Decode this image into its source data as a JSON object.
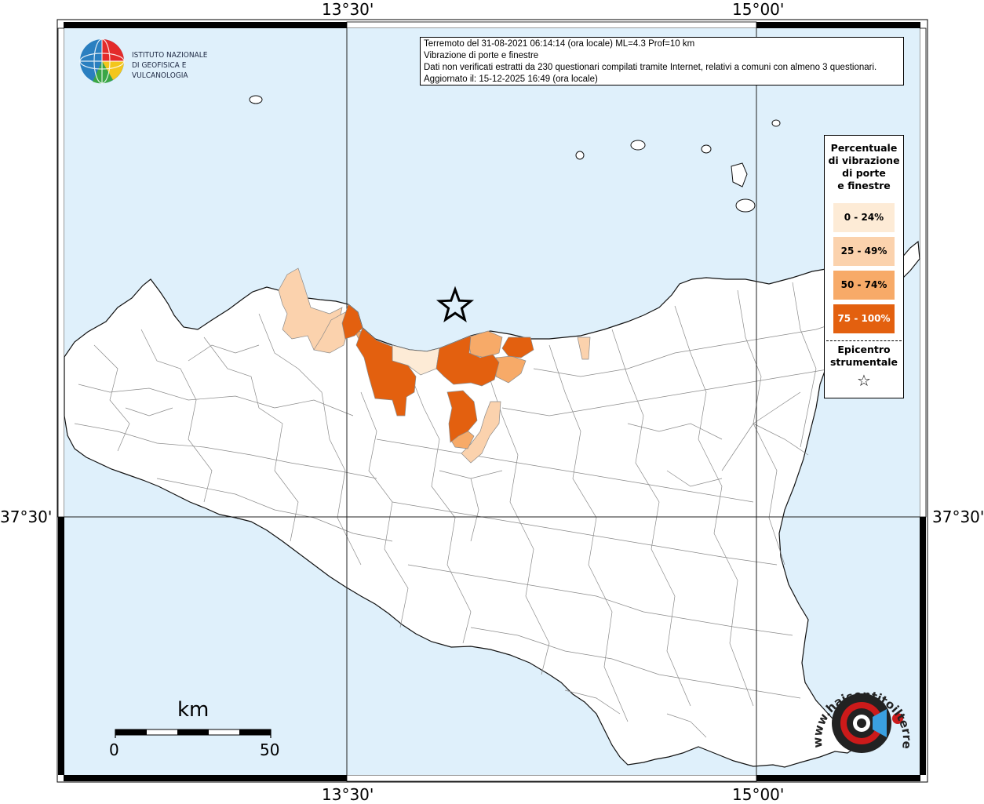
{
  "map": {
    "water_color": "#dff0fb",
    "land_color": "#ffffff",
    "border_color": "#8a8a8a",
    "coastline_color": "#111111",
    "graticule_color": "#222222"
  },
  "coords": {
    "top_left": "13°30'",
    "top_right": "15°00'",
    "bottom_left": "13°30'",
    "bottom_right": "15°00'",
    "left_lat": "37°30'",
    "right_lat": "37°30'"
  },
  "info": {
    "line1": "Terremoto del 31-08-2021 06:14:14 (ora locale) ML=4.3 Prof=10 km",
    "line2": "Vibrazione di porte e finestre",
    "line3": "Dati non verificati estratti da 230 questionari compilati tramite Internet, relativi a comuni con almeno 3 questionari.",
    "line4": "Aggiornato il: 15-12-2025 16:49 (ora locale)"
  },
  "legend": {
    "title": "Percentuale\ndi vibrazione\ndi porte\ne finestre",
    "classes": [
      {
        "label": "0 - 24%",
        "color": "#fdebd6",
        "text_color": "#000000"
      },
      {
        "label": "25 - 49%",
        "color": "#fbd2ad",
        "text_color": "#000000"
      },
      {
        "label": "50 - 74%",
        "color": "#f7aa68",
        "text_color": "#000000"
      },
      {
        "label": "75 - 100%",
        "color": "#e3600f",
        "text_color": "#ffffff"
      }
    ],
    "epicenter_title": "Epicentro\nstrumentale",
    "epicenter_symbol": "☆"
  },
  "logo": {
    "text": "ISTITUTO NAZIONALE\nDI GEOFISICA E VULCANOLOGIA",
    "icon": "ingv-globe-icon"
  },
  "scale": {
    "label": "km",
    "min": "0",
    "max": "50"
  },
  "watermark": {
    "text": "www.haisentitoilterremoto.it",
    "icon": "haisentito-logo-icon",
    "accent": "#cc1a1a"
  }
}
